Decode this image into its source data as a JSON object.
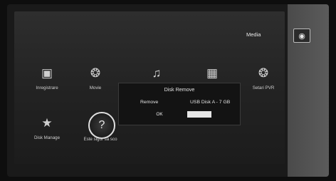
{
  "sidebar": {
    "label": "Media",
    "icon": "media-folder-icon"
  },
  "menu": {
    "items": [
      {
        "label": "Inregistrare",
        "icon": "recordings-camera-icon"
      },
      {
        "label": "Movie",
        "icon": "film-reel-icon"
      },
      {
        "label": "",
        "icon": "music-note-icon"
      },
      {
        "label": "",
        "icon": "picture-icon"
      },
      {
        "label": "Setari PVR",
        "icon": "pvr-settings-icon"
      },
      {
        "label": "Disk Manage",
        "icon": "star-icon"
      },
      {
        "label": "Este sigur sa sco",
        "icon": "help-question-icon"
      }
    ]
  },
  "dialog": {
    "title": "Disk Remove",
    "field_label": "Remove",
    "field_value": "USB Disk A - 7 GB",
    "ok_label": "OK",
    "cancel_label": ""
  }
}
